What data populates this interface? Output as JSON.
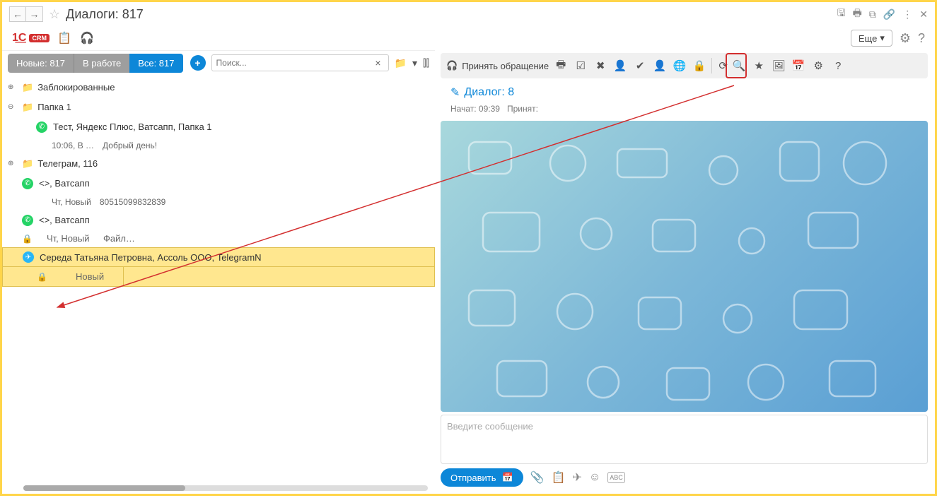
{
  "title": "Диалоги:  817",
  "topBar": {
    "moreLabel": "Еще"
  },
  "tabs": {
    "new": "Новые: 817",
    "inwork": "В работе",
    "all": "Все: 817"
  },
  "search": {
    "placeholder": "Поиск..."
  },
  "tree": {
    "blocked": "Заблокированные",
    "folder1": "Папка 1",
    "item1": "Тест, Яндекс Плюс, Ватсапп, Папка 1",
    "item1_time": "10:06, В …",
    "item1_msg": "Добрый день!",
    "telegram": "Телеграм, 116",
    "item2": "<>, Ватсапп",
    "item2_time": "Чт, Новый",
    "item2_phone": "80515099832839",
    "item3": "<>, Ватсапп",
    "item3_time": "Чт, Новый",
    "item3_file": "Файл…",
    "sel_name": "Середа Татьяна Петровна, Ассоль ООО, TelegramN",
    "sel_status": "Новый"
  },
  "rightToolbar": {
    "accept": "Принять обращение"
  },
  "dialog": {
    "title": "Диалог: 8",
    "started_label": "Начат:",
    "started_time": "09:39",
    "accepted_label": "Принят:"
  },
  "msgPlaceholder": "Введите сообщение",
  "sendLabel": "Отправить"
}
